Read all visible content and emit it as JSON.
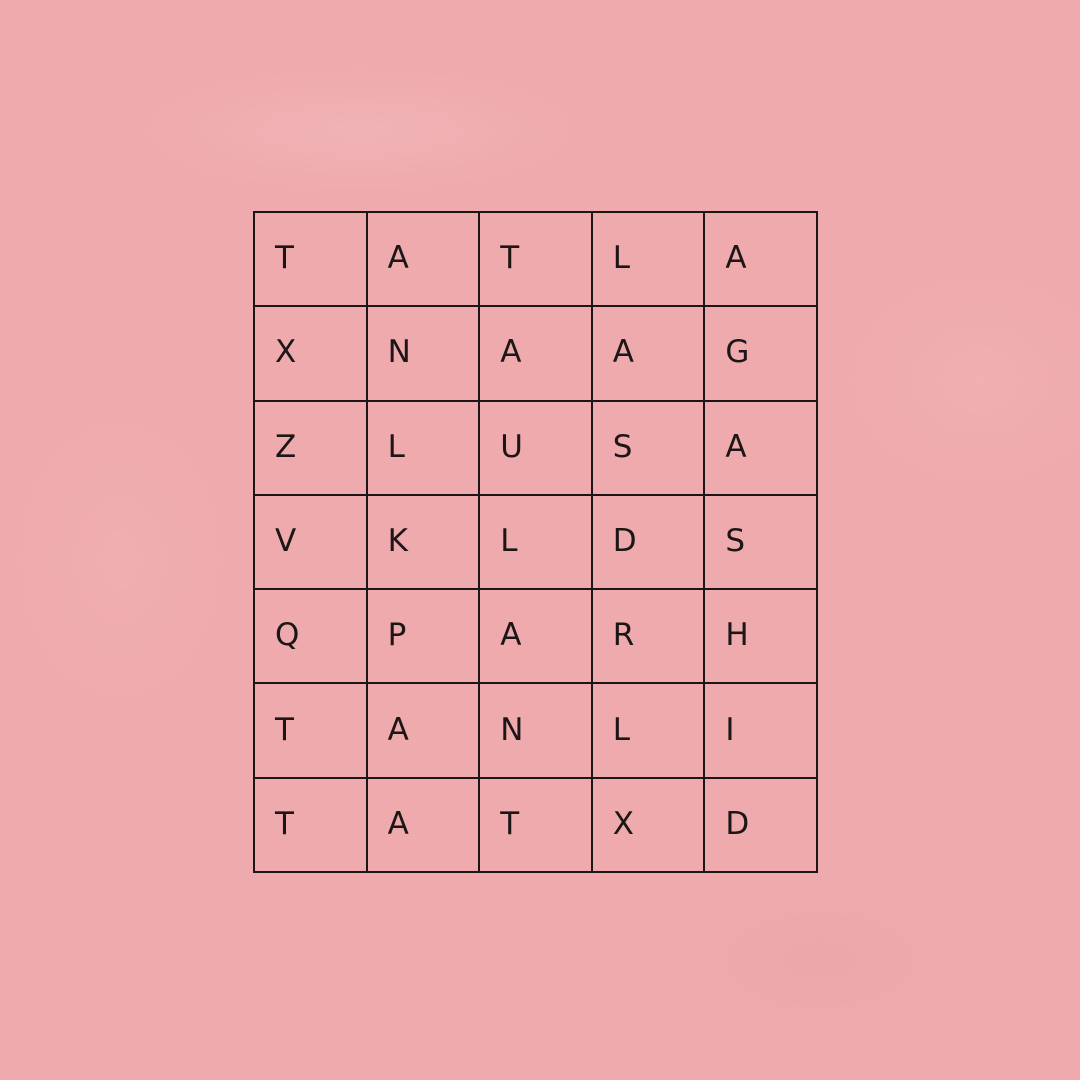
{
  "colors": {
    "background": "#efaaad",
    "grid_line": "#1c1617",
    "letter": "#1c1617"
  },
  "word_search": {
    "rows": [
      [
        "T",
        "A",
        "T",
        "L",
        "A"
      ],
      [
        "X",
        "N",
        "A",
        "A",
        "G"
      ],
      [
        "Z",
        "L",
        "U",
        "S",
        "A"
      ],
      [
        "V",
        "K",
        "L",
        "D",
        "S"
      ],
      [
        "Q",
        "P",
        "A",
        "R",
        "H"
      ],
      [
        "T",
        "A",
        "N",
        "L",
        "I"
      ],
      [
        "T",
        "A",
        "T",
        "X",
        "D"
      ]
    ]
  }
}
